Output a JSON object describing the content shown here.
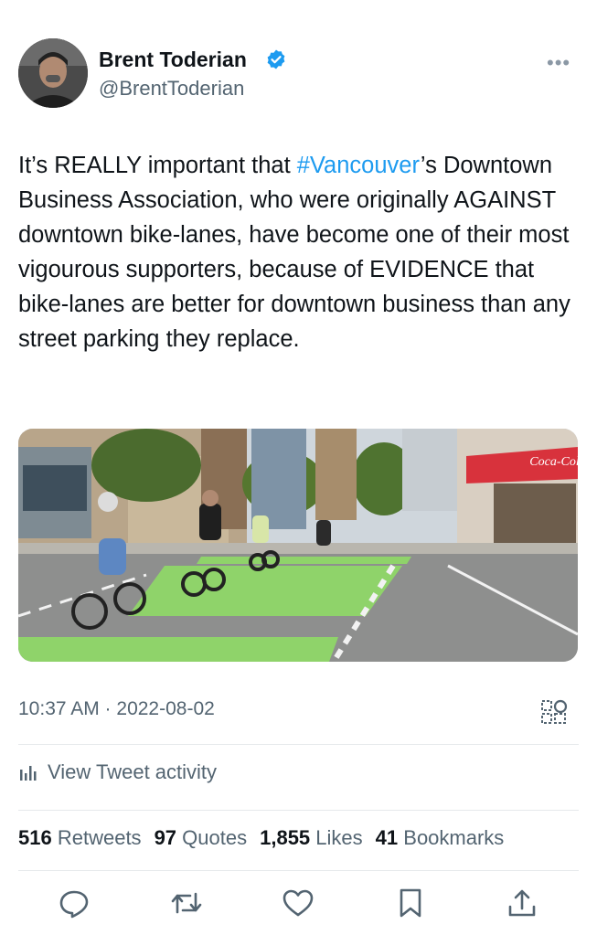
{
  "author": {
    "name": "Brent Toderian",
    "handle": "@BrentToderian",
    "verified_icon": "verified-badge-icon"
  },
  "tweet": {
    "text_before": "It’s REALLY important that ",
    "hashtag": "#Vancouver",
    "text_after": "’s Downtown Business Association, who were originally AGAINST downtown bike-lanes, have become one of their most vigourous supporters, because of EVIDENCE that bike-lanes are better for downtown business than any street parking they replace."
  },
  "media": {
    "store_sign": "Coca-Cola"
  },
  "meta": {
    "timestamp": "10:37 AM · 2022-08-02"
  },
  "activity": {
    "label": "View Tweet activity"
  },
  "stats": {
    "retweets_count": "516",
    "retweets_label": "Retweets",
    "quotes_count": "97",
    "quotes_label": "Quotes",
    "likes_count": "1,855",
    "likes_label": "Likes",
    "bookmarks_count": "41",
    "bookmarks_label": "Bookmarks"
  },
  "colors": {
    "accent": "#1d9bf0",
    "text": "#0f1419",
    "secondary": "#536471",
    "bike_lane": "#8fd36a"
  }
}
